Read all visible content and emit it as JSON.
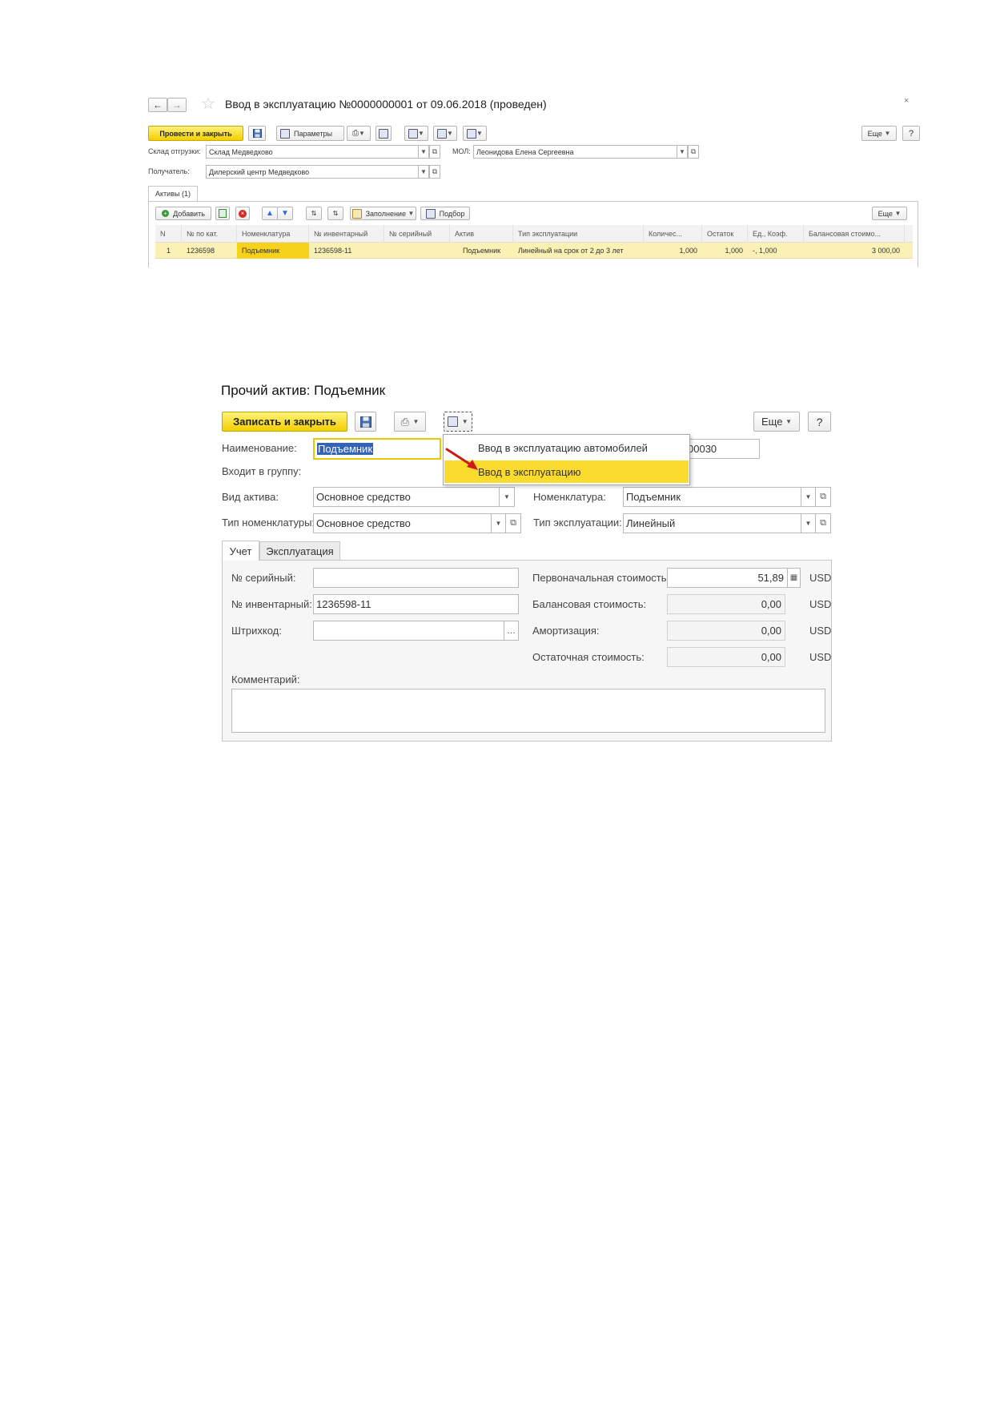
{
  "doc": {
    "title": "Ввод в эксплуатацию №0000000001 от 09.06.2018 (проведен)",
    "toolbar": {
      "post_close": "Провести и закрыть",
      "params": "Параметры",
      "more": "Еще",
      "help": "?"
    },
    "fields": {
      "warehouse_label": "Склад отгрузки:",
      "warehouse_value": "Склад Медведково",
      "mol_label": "МОЛ:",
      "mol_value": "Леонидова Елена Сергеевна",
      "recipient_label": "Получатель:",
      "recipient_value": "Дилерский центр Медведково"
    },
    "tab": "Активы (1)",
    "grid_toolbar": {
      "add": "Добавить",
      "fill": "Заполнение",
      "select": "Подбор",
      "more": "Еще"
    },
    "columns": [
      "N",
      "№ по кат.",
      "Номенклатура",
      "№ инвентарный",
      "№ серийный",
      "Актив",
      "Тип эксплуатации",
      "Количес...",
      "Остаток",
      "Ед., Коэф.",
      "Балансовая стоимо..."
    ],
    "row": {
      "n": "1",
      "cat": "1236598",
      "nom": "Подъемник",
      "inv": "1236598-11",
      "serial": "",
      "asset": "Подъемник",
      "type": "Линейный на срок от 2 до 3 лет",
      "qty": "1,000",
      "rest": "1,000",
      "unit": "-, 1,000",
      "balance": "3 000,00"
    }
  },
  "form": {
    "title": "Прочий актив: Подъемник",
    "toolbar": {
      "save_close": "Записать и закрыть",
      "more": "Еще",
      "help": "?"
    },
    "menu": {
      "item1": "Ввод в эксплуатацию автомобилей",
      "item2": "Ввод в эксплуатацию"
    },
    "fields": {
      "name_label": "Наименование:",
      "name_value": "Подъемник",
      "code_value": "00030",
      "group_label": "Входит в группу:",
      "asset_type_label": "Вид актива:",
      "asset_type_value": "Основное средство",
      "nom_label": "Номенклатура:",
      "nom_value": "Подъемник",
      "nom_type_label": "Тип номенклатуры:",
      "nom_type_value": "Основное средство",
      "exp_type_label": "Тип эксплуатации:",
      "exp_type_value": "Линейный"
    },
    "tabs": [
      "Учет",
      "Эксплуатация"
    ],
    "accounting": {
      "serial_label": "№ серийный:",
      "serial_value": "",
      "inv_label": "№ инвентарный:",
      "inv_value": "1236598-11",
      "barcode_label": "Штрихкод:",
      "barcode_value": "",
      "initial_cost_label": "Первоначальная стоимость:",
      "initial_cost_value": "51,89",
      "balance_cost_label": "Балансовая стоимость:",
      "balance_cost_value": "0,00",
      "depreciation_label": "Амортизация:",
      "depreciation_value": "0,00",
      "residual_label": "Остаточная стоимость:",
      "residual_value": "0,00",
      "currency": "USD",
      "comment_label": "Комментарий:",
      "comment_value": ""
    }
  }
}
